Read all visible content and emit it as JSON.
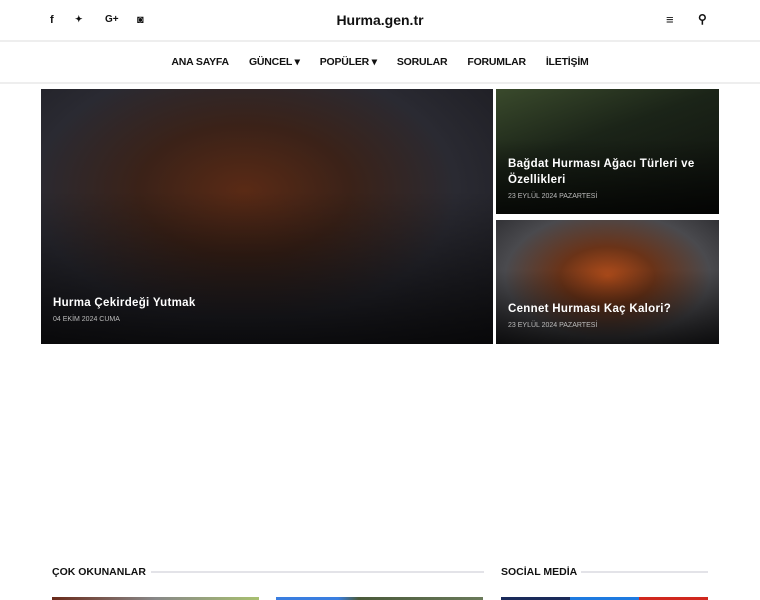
{
  "header": {
    "title": "Hurma.gen.tr",
    "social": [
      {
        "icon": "facebook-icon",
        "glyph": "f"
      },
      {
        "icon": "twitter-icon",
        "glyph": "🐦"
      },
      {
        "icon": "google-plus-icon",
        "glyph": "G+"
      },
      {
        "icon": "instagram-icon",
        "glyph": "◙"
      }
    ],
    "menu_glyph": "≡",
    "search_glyph": "⚲"
  },
  "nav": [
    {
      "label": "ANA SAYFA"
    },
    {
      "label": "GÜNCEL ▾"
    },
    {
      "label": "POPÜLER ▾"
    },
    {
      "label": "SORULAR"
    },
    {
      "label": "FORUMLAR"
    },
    {
      "label": "İLETİŞİM"
    }
  ],
  "featured": [
    {
      "title": "Hurma Çekirdeği Yutmak",
      "date": "04 EKİM 2024 CUMA"
    },
    {
      "title": "Bağdat Hurması Ağacı Türleri ve Özellikleri",
      "date": "23 EYLÜL 2024 PAZARTESİ"
    },
    {
      "title": "Cennet Hurması Kaç Kalori?",
      "date": "23 EYLÜL 2024 PAZARTESİ"
    }
  ],
  "sections": {
    "popular": "ÇOK OKUNANLAR",
    "social": "SOCİAL MEDİA"
  }
}
